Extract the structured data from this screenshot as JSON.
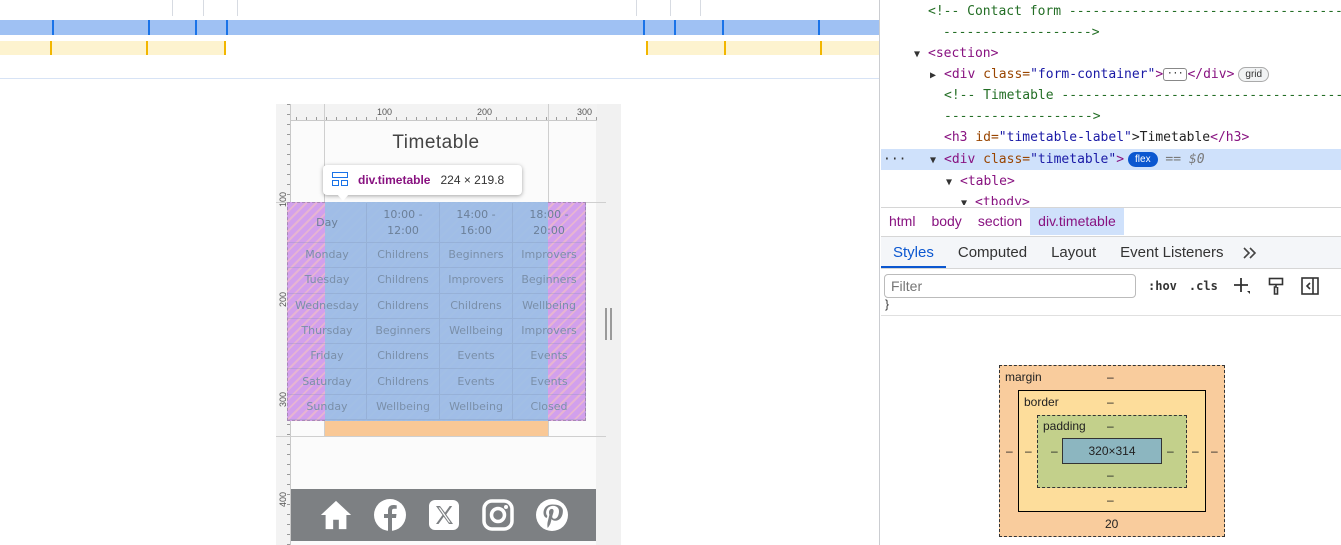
{
  "preview": {
    "page_title": "Timetable",
    "ruler_top_labels": [
      "100",
      "200",
      "300"
    ],
    "ruler_left_labels": [
      "100",
      "200",
      "300",
      "400"
    ],
    "tooltip": {
      "selector": "div.timetable",
      "dimensions": "224 × 219.8"
    },
    "timetable": {
      "header": [
        "Day",
        "10:00 - 12:00",
        "14:00 - 16:00",
        "18:00 - 20:00"
      ],
      "rows": [
        [
          "Monday",
          "Childrens",
          "Beginners",
          "Improvers"
        ],
        [
          "Tuesday",
          "Childrens",
          "Improvers",
          "Beginners"
        ],
        [
          "Wednesday",
          "Childrens",
          "Childrens",
          "Wellbeing"
        ],
        [
          "Thursday",
          "Beginners",
          "Wellbeing",
          "Improvers"
        ],
        [
          "Friday",
          "Childrens",
          "Events",
          "Events"
        ],
        [
          "Saturday",
          "Childrens",
          "Events",
          "Events"
        ],
        [
          "Sunday",
          "Wellbeing",
          "Wellbeing",
          "Closed"
        ]
      ]
    },
    "footer_icons": [
      "home-icon",
      "facebook-icon",
      "x-twitter-icon",
      "instagram-icon",
      "pinterest-icon"
    ]
  },
  "devtools": {
    "dom": {
      "comment_contact_1": "<!-- Contact form ---------------------------------------",
      "comment_contact_2": "------------------->",
      "section_tag": "<section>",
      "form_div_open": "<div",
      "form_attr": "class=",
      "form_val": "\"form-container\"",
      "form_close": ">",
      "form_end": "</div>",
      "grid_badge": "grid",
      "comment_tt_1": "<!-- Timetable ------------------------------------------",
      "comment_tt_2": "------------------->",
      "h3_open": "<h3",
      "h3_attr": "id=",
      "h3_val": "\"timetable-label\"",
      "h3_text": ">Timetable",
      "h3_close": "</h3>",
      "tt_div_open": "<div",
      "tt_attr": "class=",
      "tt_val": "\"timetable\"",
      "tt_close": ">",
      "flex_badge": "flex",
      "dollar0": "== $0",
      "table_tag": "<table>",
      "tbody_tag": "<tbody>"
    },
    "breadcrumbs": [
      "html",
      "body",
      "section",
      "div.timetable"
    ],
    "subtabs": [
      "Styles",
      "Computed",
      "Layout",
      "Event Listeners"
    ],
    "filter_placeholder": "Filter",
    "hov": ":hov",
    "cls": ".cls",
    "box_model": {
      "margin_label": "margin",
      "border_label": "border",
      "padding_label": "padding",
      "content": "320×314",
      "dash": "–",
      "margin_bottom": "20"
    }
  },
  "colors": {
    "accent": "#0b57d0",
    "element_blue": "#9cc0e6",
    "margin_orange": "#f9cc9d",
    "flex_gap_purple": "#d2a0ec"
  }
}
